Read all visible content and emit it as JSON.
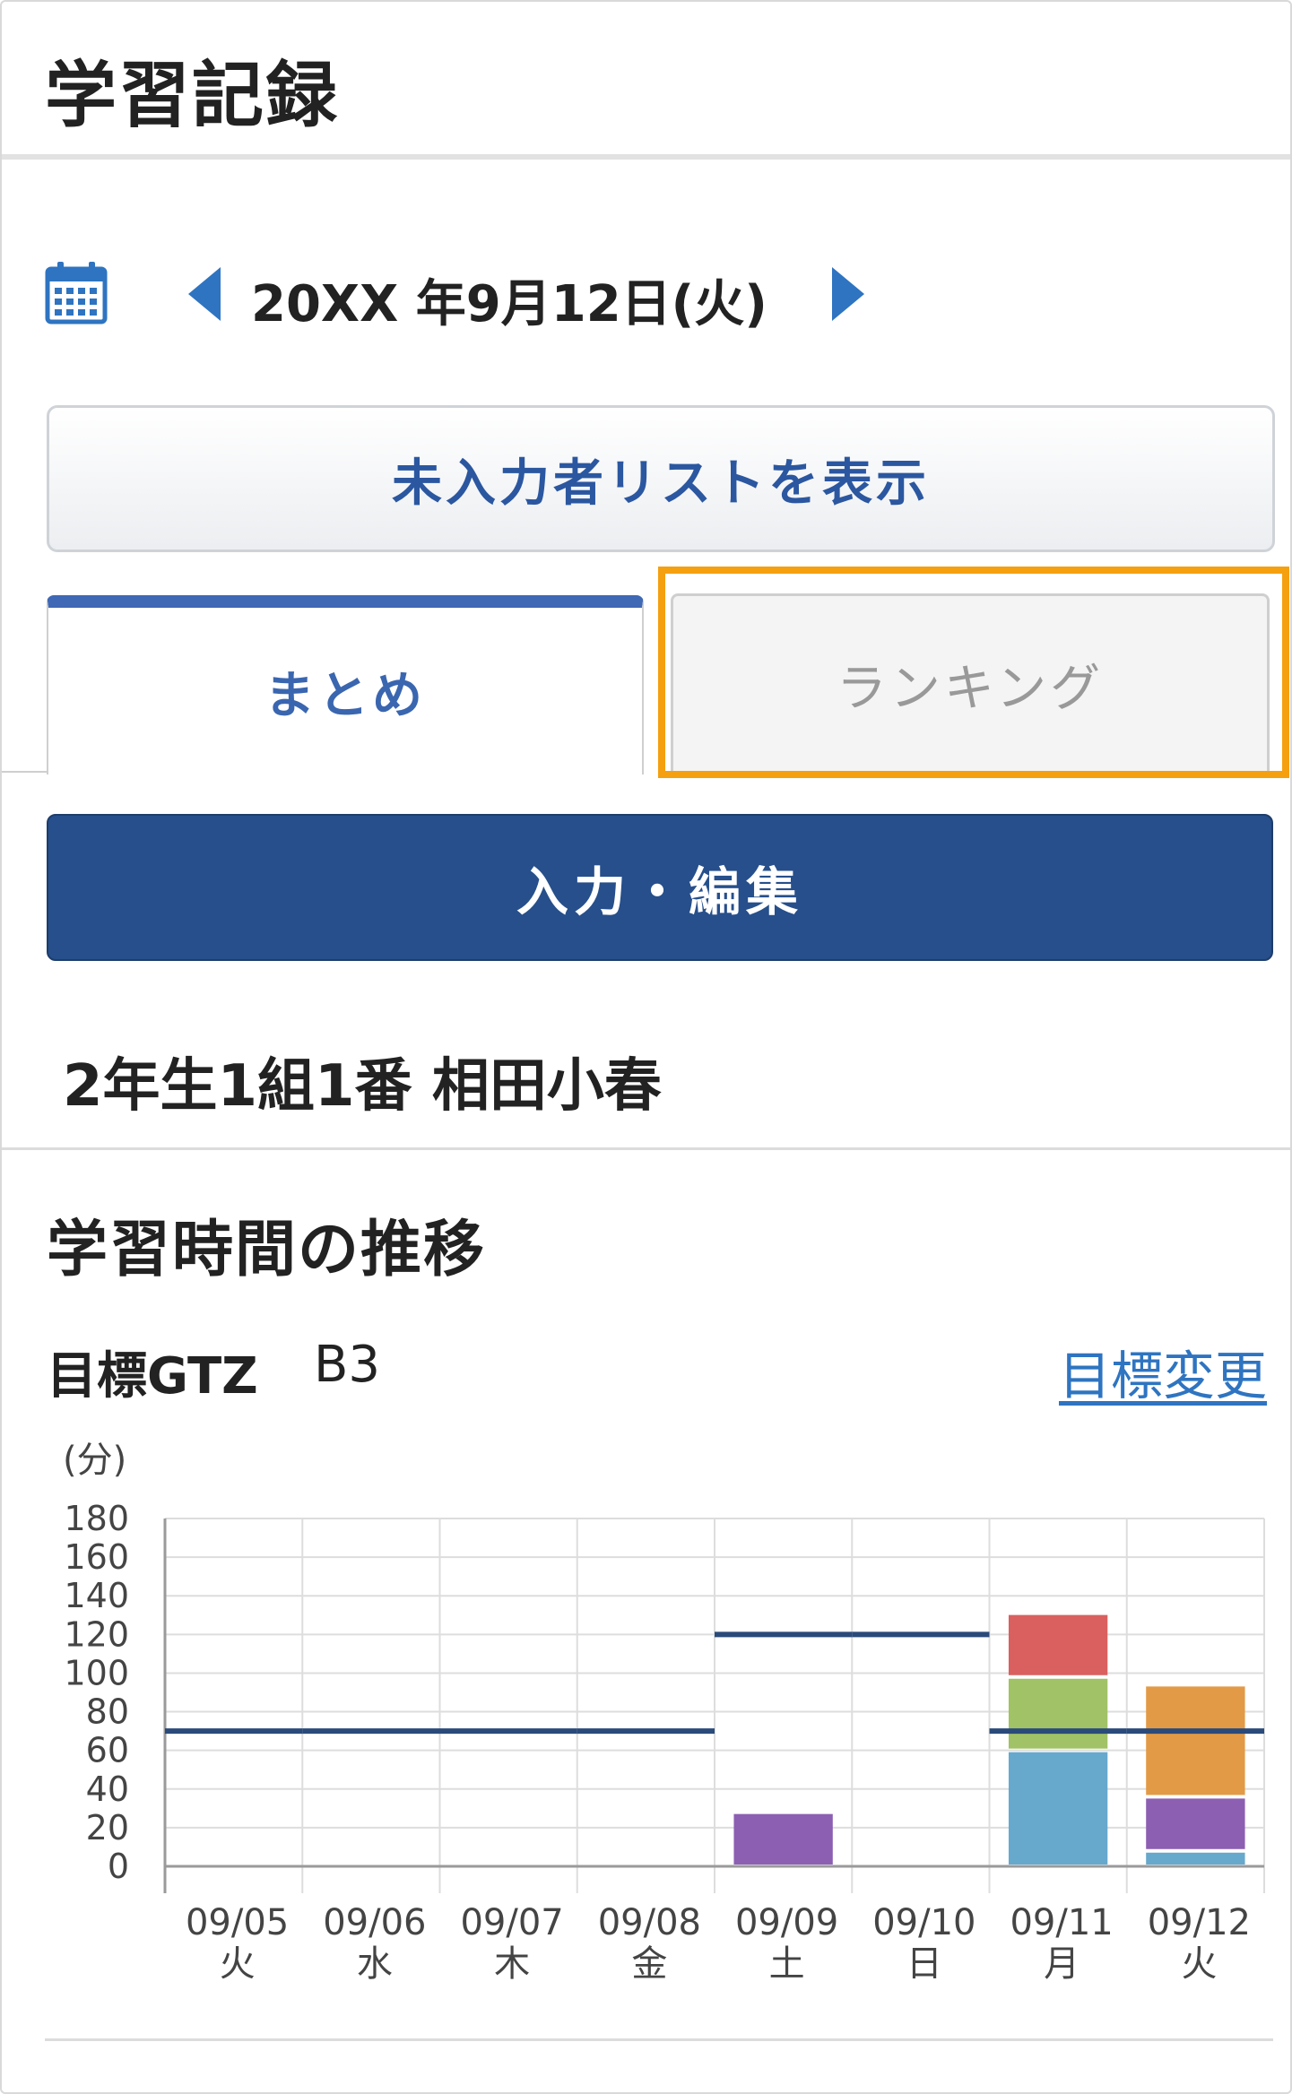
{
  "page": {
    "title": "学習記録",
    "date": "20XX 年9月12日(火)",
    "unentered_button": "未入力者リストを表示",
    "tabs": [
      {
        "label": "まとめ",
        "active": true
      },
      {
        "label": "ランキング",
        "active": false,
        "highlighted": true
      }
    ],
    "edit_button": "入力・編集",
    "student": "2年生1組1番 相田小春",
    "section_title": "学習時間の推移",
    "goal": {
      "label": "目標GTZ",
      "value": "B3",
      "change_link": "目標変更"
    }
  },
  "colors": {
    "accent_blue": "#2e74c1",
    "tab_active": "#3f68b5",
    "edit_button": "#264f8b",
    "highlight": "#f5a00f",
    "goal_line": "#2a4a7a"
  },
  "icons": {
    "calendar": "calendar-icon",
    "prev": "caret-left-icon",
    "next": "caret-right-icon"
  },
  "chart_data": {
    "type": "bar",
    "stacked": true,
    "ylabel": "(分)",
    "ylim": [
      0,
      180
    ],
    "yticks": [
      0,
      20,
      40,
      60,
      80,
      100,
      120,
      140,
      160,
      180
    ],
    "grid": true,
    "categories": [
      "09/05",
      "09/06",
      "09/07",
      "09/08",
      "09/09",
      "09/10",
      "09/11",
      "09/12"
    ],
    "weekdays": [
      "火",
      "水",
      "木",
      "金",
      "土",
      "日",
      "月",
      "火"
    ],
    "series": [
      {
        "color": "#67a8cd",
        "values": [
          0,
          0,
          0,
          0,
          0,
          0,
          60,
          8
        ]
      },
      {
        "color": "#8c5fb2",
        "values": [
          0,
          0,
          0,
          0,
          28,
          0,
          0,
          28
        ]
      },
      {
        "color": "#e29a47",
        "values": [
          0,
          0,
          0,
          0,
          0,
          0,
          0,
          58
        ]
      },
      {
        "color": "#a1c266",
        "values": [
          0,
          0,
          0,
          0,
          0,
          0,
          38,
          0
        ]
      },
      {
        "color": "#d9605f",
        "values": [
          0,
          0,
          0,
          0,
          0,
          0,
          33,
          0
        ]
      }
    ],
    "goal_line": [
      70,
      70,
      70,
      70,
      120,
      120,
      70,
      70
    ]
  }
}
